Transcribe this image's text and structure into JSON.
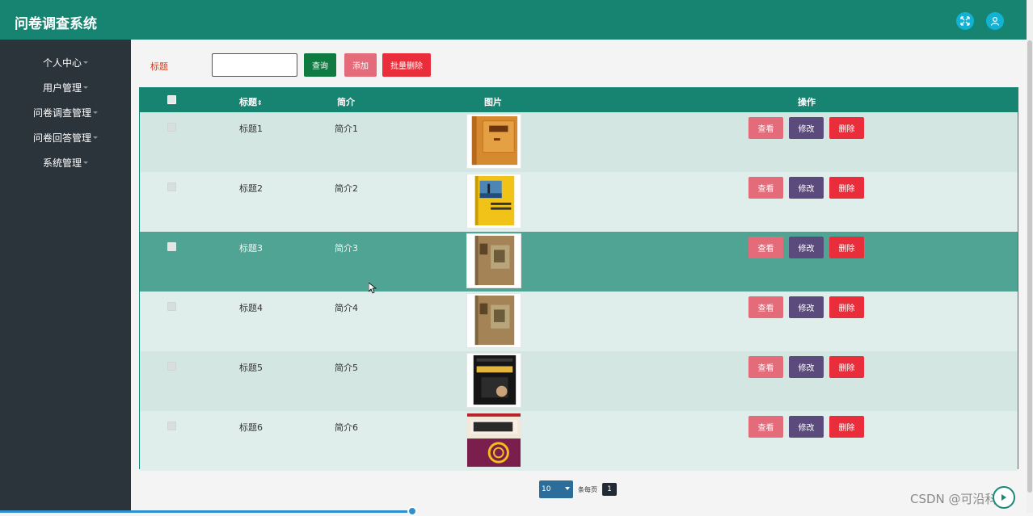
{
  "app": {
    "title": "问卷调查系统"
  },
  "header_icons": [
    {
      "name": "fullscreen-icon"
    },
    {
      "name": "user-icon"
    }
  ],
  "sidebar": {
    "items": [
      {
        "label": "个人中心"
      },
      {
        "label": "用户管理"
      },
      {
        "label": "问卷调查管理"
      },
      {
        "label": "问卷回答管理"
      },
      {
        "label": "系统管理"
      }
    ]
  },
  "search": {
    "label": "标题",
    "value": "",
    "query_label": "查询",
    "add_label": "添加",
    "bulk_delete_label": "批量删除"
  },
  "table": {
    "headers": {
      "title": "标题",
      "sort_icon": "⇕",
      "intro": "简介",
      "image": "图片",
      "actions": "操作"
    },
    "action_labels": {
      "view": "查看",
      "edit": "修改",
      "delete": "删除"
    },
    "rows": [
      {
        "title": "标题1",
        "intro": "简介1",
        "image": "book-cover-1"
      },
      {
        "title": "标题2",
        "intro": "简介2",
        "image": "book-cover-2"
      },
      {
        "title": "标题3",
        "intro": "简介3",
        "image": "book-cover-3"
      },
      {
        "title": "标题4",
        "intro": "简介4",
        "image": "book-cover-4"
      },
      {
        "title": "标题5",
        "intro": "简介5",
        "image": "book-cover-5"
      },
      {
        "title": "标题6",
        "intro": "简介6",
        "image": "book-cover-6"
      }
    ]
  },
  "pagination": {
    "page_size": "10",
    "page_size_suffix": "条每页",
    "current_page": "1"
  },
  "watermark": "CSDN @可沿科技",
  "colors": {
    "primary": "#178472",
    "sidebar": "#2b333b",
    "query": "#0f7a41",
    "add": "#e36b7a",
    "delete": "#ea2d3a",
    "edit": "#5b4b7c",
    "row_hover": "#4fa493"
  }
}
